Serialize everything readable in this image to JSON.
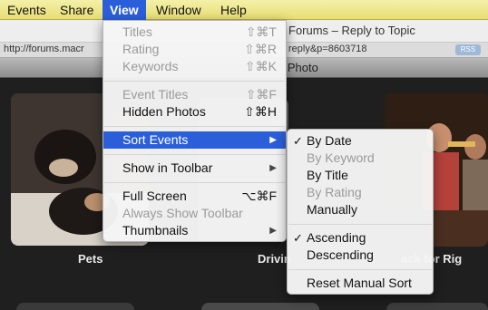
{
  "menubar": {
    "items": [
      "Events",
      "Share",
      "View",
      "Window",
      "Help"
    ],
    "active": "View"
  },
  "browser": {
    "title": "Forums – Reply to Topic",
    "url": "http://forums.macr",
    "url_tail": "reply&p=8603718",
    "rss": "RSS"
  },
  "iphoto": {
    "title": "iPhoto"
  },
  "events": [
    {
      "label": "Pets"
    },
    {
      "label": "Drivin"
    },
    {
      "label": "ack for Rig"
    }
  ],
  "view_menu": {
    "titles": {
      "label": "Titles",
      "shortcut": "⇧⌘T"
    },
    "rating": {
      "label": "Rating",
      "shortcut": "⇧⌘R"
    },
    "keywords": {
      "label": "Keywords",
      "shortcut": "⇧⌘K"
    },
    "event_titles": {
      "label": "Event Titles",
      "shortcut": "⇧⌘F"
    },
    "hidden_photos": {
      "label": "Hidden Photos",
      "shortcut": "⇧⌘H"
    },
    "sort_events": {
      "label": "Sort Events"
    },
    "show_in_toolbar": {
      "label": "Show in Toolbar"
    },
    "full_screen": {
      "label": "Full Screen",
      "shortcut": "⌥⌘F"
    },
    "always_show_toolbar": {
      "label": "Always Show Toolbar"
    },
    "thumbnails": {
      "label": "Thumbnails"
    }
  },
  "sort_menu": {
    "by_date": {
      "label": "By Date",
      "checked": true
    },
    "by_keyword": {
      "label": "By Keyword"
    },
    "by_title": {
      "label": "By Title"
    },
    "by_rating": {
      "label": "By Rating"
    },
    "manually": {
      "label": "Manually"
    },
    "ascending": {
      "label": "Ascending",
      "checked": true
    },
    "descending": {
      "label": "Descending"
    },
    "reset_manual_sort": {
      "label": "Reset Manual Sort"
    }
  },
  "colors": {
    "menu_highlight": "#2b5fd9",
    "menubar": "#efe79a"
  }
}
